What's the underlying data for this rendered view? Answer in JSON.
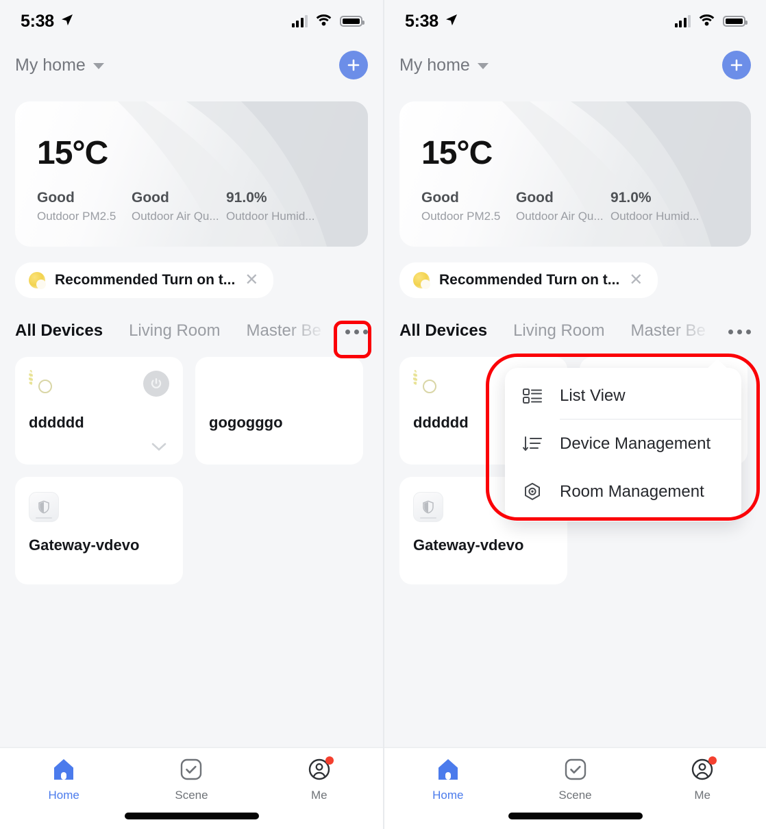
{
  "status_bar": {
    "time": "5:38",
    "location_icon": "location-arrow-icon",
    "cellular_icon": "cellular-signal-icon",
    "wifi_icon": "wifi-icon",
    "battery_icon": "battery-icon"
  },
  "nav": {
    "home_name": "My home",
    "dropdown_icon": "chevron-down-icon",
    "add_icon": "plus-icon"
  },
  "weather": {
    "temperature": "15°C",
    "metrics": [
      {
        "value": "Good",
        "label": "Outdoor PM2.5"
      },
      {
        "value": "Good",
        "label": "Outdoor Air Qu..."
      },
      {
        "value": "91.0%",
        "label": "Outdoor Humid..."
      }
    ]
  },
  "recommendation": {
    "icon": "moon-icon",
    "text": "Recommended Turn on t...",
    "close_icon": "close-icon"
  },
  "tabs": {
    "items": [
      {
        "label": "All Devices",
        "active": true
      },
      {
        "label": "Living Room",
        "active": false
      },
      {
        "label": "Master Be",
        "active": false
      }
    ],
    "more_icon": "ellipsis-icon"
  },
  "devices": [
    {
      "name": "dddddd",
      "icon": "ring-light-icon",
      "power_icon": "power-icon",
      "expand_icon": "chevron-down-icon"
    },
    {
      "name": "gogogggo",
      "icon": "dark-device-icon"
    },
    {
      "name": "Gateway-vdevo",
      "icon": "gateway-shield-icon"
    }
  ],
  "popup_menu": {
    "items": [
      {
        "label": "List View",
        "icon": "list-view-icon"
      },
      {
        "label": "Device Management",
        "icon": "sort-list-icon"
      },
      {
        "label": "Room Management",
        "icon": "hexagon-target-icon"
      }
    ]
  },
  "tabbar": {
    "items": [
      {
        "label": "Home",
        "icon": "home-icon",
        "active": true,
        "badge": false
      },
      {
        "label": "Scene",
        "icon": "checkbox-icon",
        "active": false,
        "badge": false
      },
      {
        "label": "Me",
        "icon": "profile-icon",
        "active": false,
        "badge": true
      }
    ]
  },
  "annotations": {
    "accent_red": "#fb0007",
    "accent_blue": "#4b7bec",
    "add_button_blue": "#6c8ee8"
  }
}
